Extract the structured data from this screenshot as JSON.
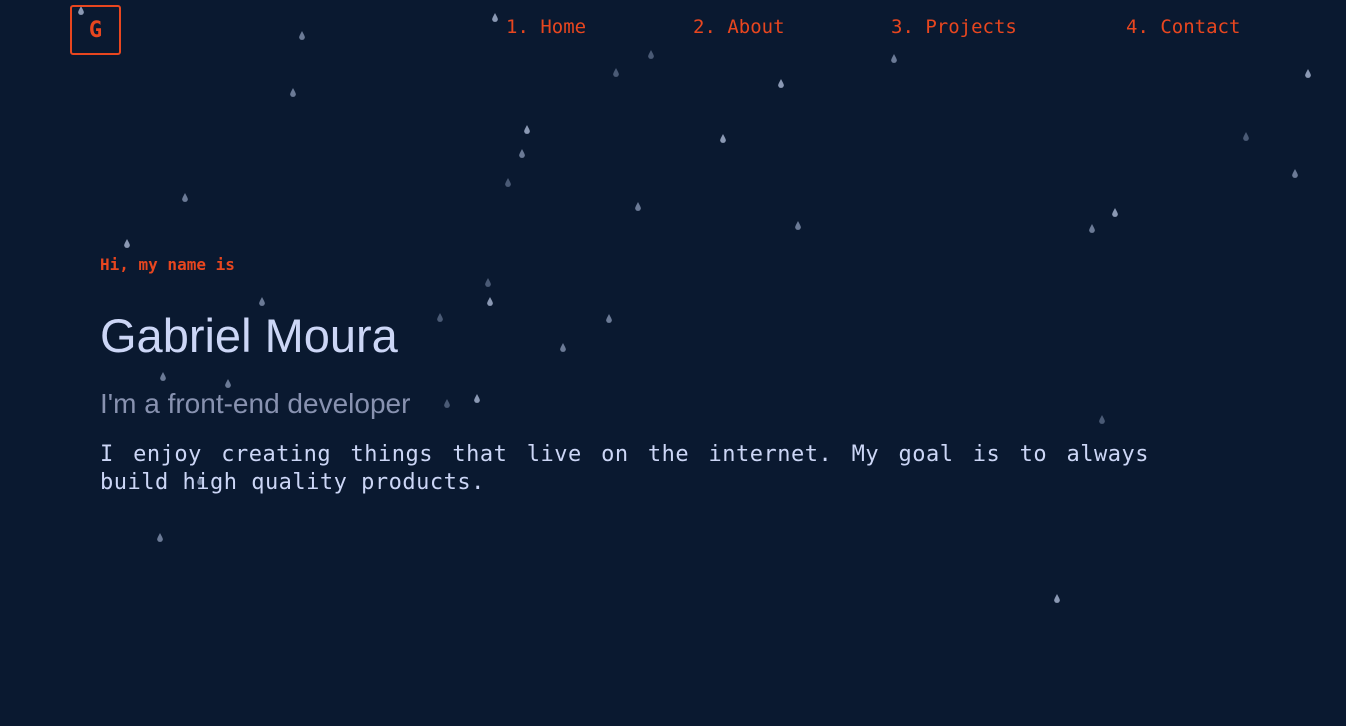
{
  "header": {
    "logo_letter": "G",
    "nav": [
      {
        "label": "1. Home"
      },
      {
        "label": "2. About"
      },
      {
        "label": "3. Projects"
      },
      {
        "label": "4. Contact"
      }
    ]
  },
  "hero": {
    "greeting": "Hi, my name is",
    "name": "Gabriel Moura",
    "role": "I'm a front-end developer",
    "bio": "I enjoy creating things that live on the internet. My goal is to always build high quality products."
  },
  "colors": {
    "background": "#0a1930",
    "accent": "#e8461f",
    "heading": "#ccd6f6",
    "muted": "#8892b0",
    "raindrop": "#8a98b3"
  },
  "icons": {
    "logo": "letter-g-logo",
    "background_decoration": "raindrop-icon"
  }
}
